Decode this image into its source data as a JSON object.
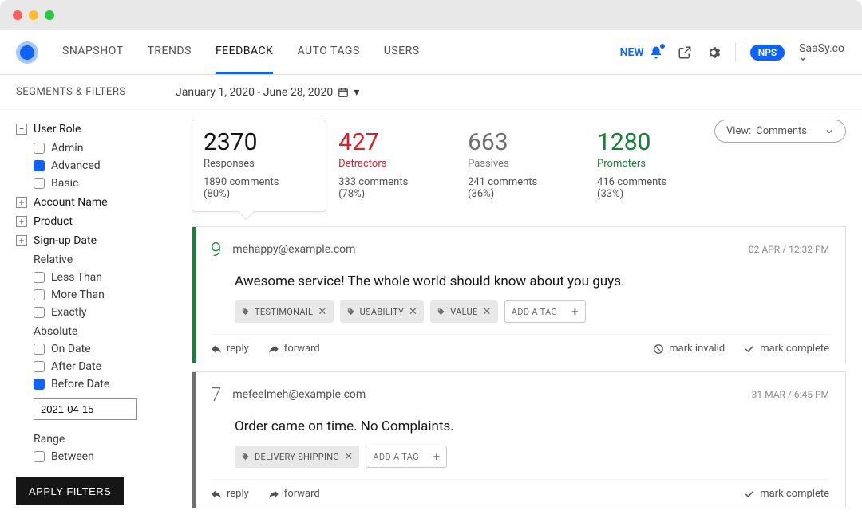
{
  "nav": {
    "items": [
      "SNAPSHOT",
      "TRENDS",
      "FEEDBACK",
      "AUTO TAGS",
      "USERS"
    ],
    "new": "NEW",
    "nps_badge": "NPS",
    "company": "SaaSy.co"
  },
  "subheader": {
    "segments_title": "SEGMENTS & FILTERS",
    "date_range": "January 1, 2020 - June 28, 2020"
  },
  "sidebar": {
    "groups": [
      {
        "label": "User Role",
        "expanded": true,
        "options": [
          {
            "label": "Admin",
            "checked": false
          },
          {
            "label": "Advanced",
            "checked": true
          },
          {
            "label": "Basic",
            "checked": false
          }
        ]
      },
      {
        "label": "Account Name",
        "expanded": false
      },
      {
        "label": "Product",
        "expanded": false
      },
      {
        "label": "Sign-up Date",
        "expanded": false
      }
    ],
    "relative_label": "Relative",
    "relative_opts": [
      {
        "label": "Less Than",
        "checked": false
      },
      {
        "label": "More Than",
        "checked": false
      },
      {
        "label": "Exactly",
        "checked": false
      }
    ],
    "absolute_label": "Absolute",
    "absolute_opts": [
      {
        "label": "On Date",
        "checked": false
      },
      {
        "label": "After Date",
        "checked": false
      },
      {
        "label": "Before Date",
        "checked": true
      }
    ],
    "date_value": "2021-04-15",
    "range_label": "Range",
    "range_opts": [
      {
        "label": "Between",
        "checked": false
      }
    ],
    "apply": "APPLY FILTERS"
  },
  "stats": {
    "responses": {
      "num": "2370",
      "label": "Responses",
      "sub": "1890 comments (80%)"
    },
    "detractors": {
      "num": "427",
      "label": "Detractors",
      "sub": "333 comments (78%)"
    },
    "passives": {
      "num": "663",
      "label": "Passives",
      "sub": "241 comments (36%)"
    },
    "promoters": {
      "num": "1280",
      "label": "Promoters",
      "sub": "416 comments (33%)"
    },
    "view_label": "View:",
    "view_value": "Comments"
  },
  "feedback": [
    {
      "score": "9",
      "score_class": "green",
      "email": "mehappy@example.com",
      "timestamp": "02 APR / 12:32 PM",
      "comment": "Awesome service! The whole world should know about you guys.",
      "tags": [
        "TESTIMONAIL",
        "USABILITY",
        "VALUE"
      ],
      "add_tag": "ADD A TAG",
      "show_invalid": true
    },
    {
      "score": "7",
      "score_class": "gray",
      "email": "mefeelmeh@example.com",
      "timestamp": "31 MAR / 6:45 PM",
      "comment": "Order came on time. No Complaints.",
      "tags": [
        "DELIVERY-SHIPPING"
      ],
      "add_tag": "ADD A TAG",
      "show_invalid": false
    }
  ],
  "actions": {
    "reply": "reply",
    "forward": "forward",
    "mark_invalid": "mark invalid",
    "mark_complete": "mark complete"
  }
}
